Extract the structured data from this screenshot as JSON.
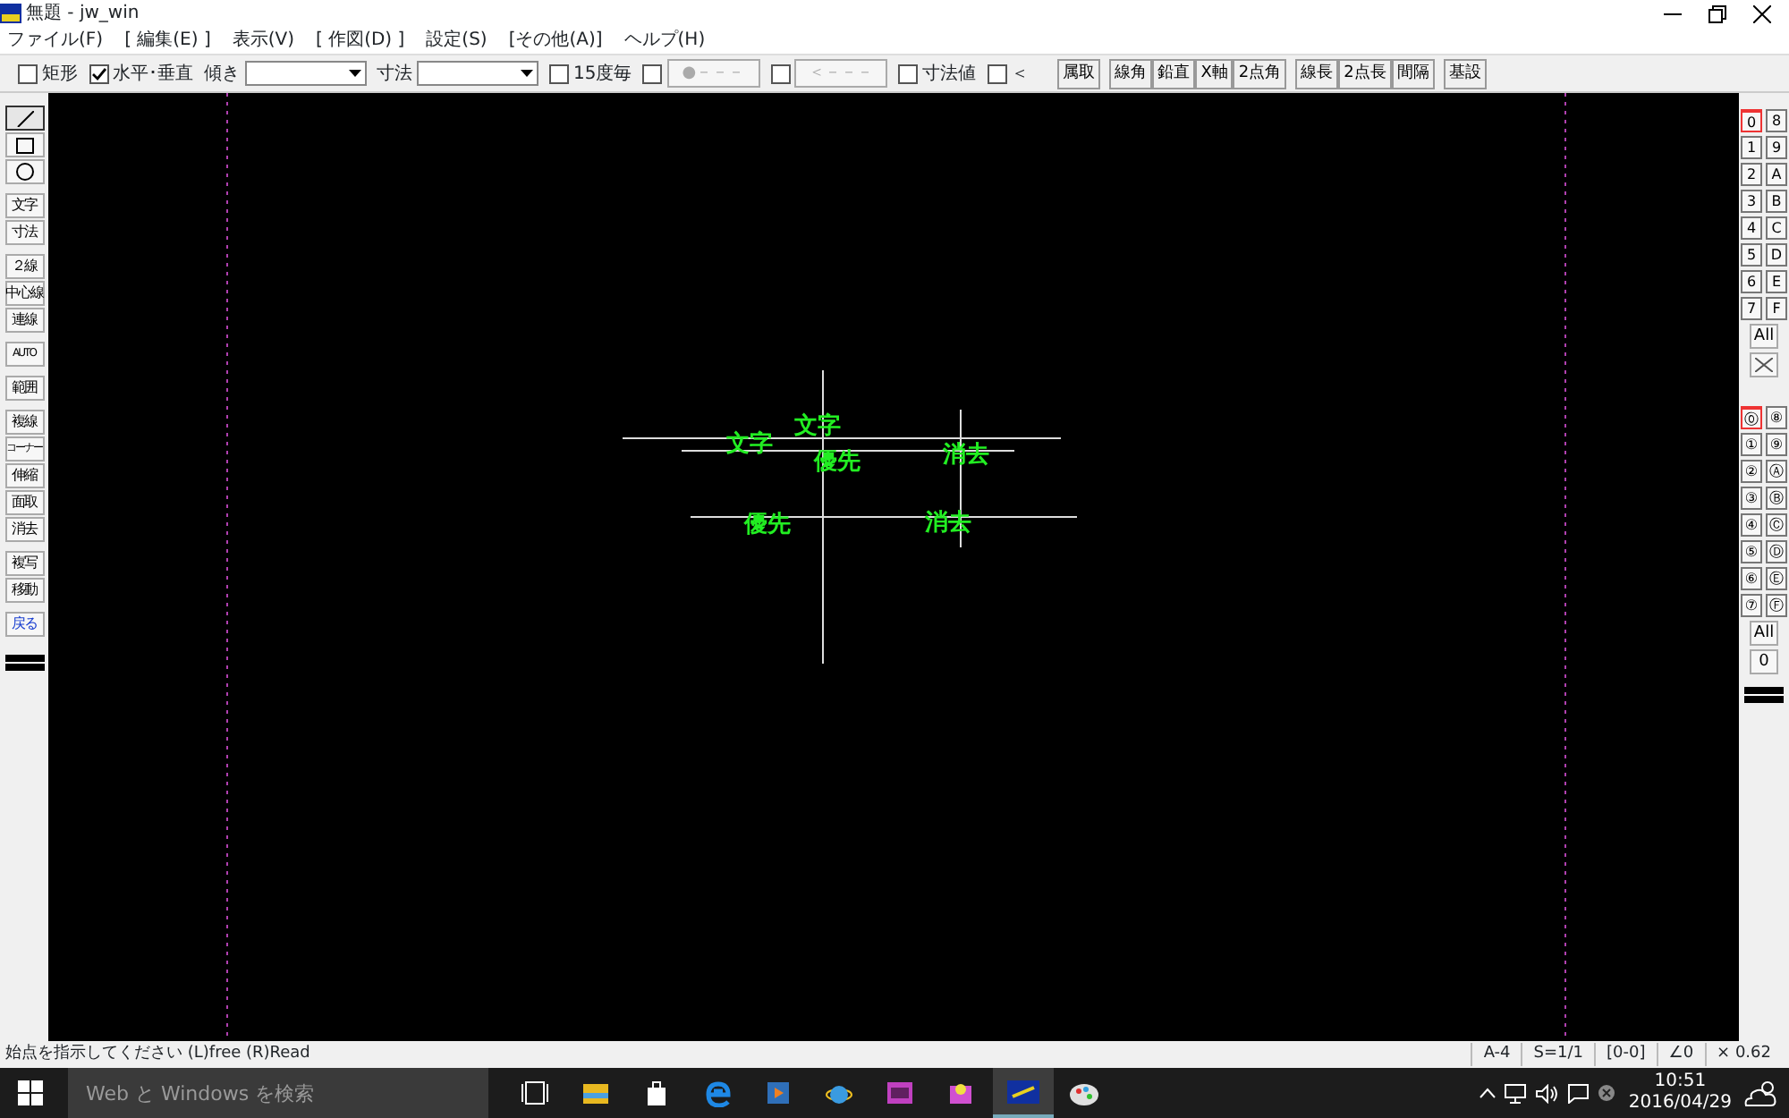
{
  "window": {
    "title": "無題 - jw_win"
  },
  "menu": [
    "ファイル(F)",
    "[ 編集(E) ]",
    "表示(V)",
    "[ 作図(D) ]",
    "設定(S)",
    "[その他(A)]",
    "ヘルプ(H)"
  ],
  "toolbar": {
    "items": [
      {
        "kind": "checkbox",
        "label": "矩形",
        "checked": false
      },
      {
        "kind": "checkbox",
        "label": "水平･垂直",
        "checked": true
      },
      {
        "kind": "combo",
        "label": "傾き"
      },
      {
        "kind": "combo",
        "label": "寸法"
      },
      {
        "kind": "checkbox",
        "label": "15度毎",
        "checked": false
      },
      {
        "kind": "checkbutton",
        "label": "●－－－",
        "checked": false,
        "disabled": true
      },
      {
        "kind": "checkbutton",
        "label": "＜－－－",
        "checked": false,
        "disabled": true
      },
      {
        "kind": "checkbox",
        "label": "寸法値",
        "checked": false
      },
      {
        "kind": "checkbox",
        "label": "＜",
        "checked": false
      }
    ],
    "button_groups": [
      [
        "属取"
      ],
      [
        "線角",
        "鉛直",
        "X軸",
        "2点角"
      ],
      [
        "線長",
        "2点長",
        "間隔"
      ],
      [
        "基設"
      ]
    ]
  },
  "left_tools": [
    [
      {
        "kind": "line",
        "selected": true
      },
      {
        "kind": "rect",
        "selected": false
      },
      {
        "kind": "circle",
        "selected": false
      }
    ],
    [
      {
        "kind": "text",
        "label": "文字",
        "selected": false
      },
      {
        "kind": "text",
        "label": "寸法",
        "selected": false
      }
    ],
    [
      {
        "kind": "text",
        "label": "２線",
        "selected": false
      },
      {
        "kind": "text",
        "label": "中心線",
        "selected": false
      },
      {
        "kind": "text",
        "label": "連線",
        "selected": false
      }
    ],
    [
      {
        "kind": "text",
        "label": "AUTO",
        "selected": false
      }
    ],
    [
      {
        "kind": "text",
        "label": "範囲",
        "selected": false
      }
    ],
    [
      {
        "kind": "text",
        "label": "複線",
        "selected": false
      },
      {
        "kind": "text",
        "label": "コーナー",
        "selected": false
      },
      {
        "kind": "text",
        "label": "伸縮",
        "selected": false
      },
      {
        "kind": "text",
        "label": "面取",
        "selected": false
      },
      {
        "kind": "text",
        "label": "消去",
        "selected": false
      }
    ],
    [
      {
        "kind": "text",
        "label": "複写",
        "selected": false
      },
      {
        "kind": "text",
        "label": "移動",
        "selected": false
      }
    ],
    [
      {
        "kind": "accent",
        "label": "戻る",
        "selected": false
      }
    ]
  ],
  "canvas_texts": [
    "文字",
    "文字",
    "優先",
    "消去",
    "優先",
    "消去"
  ],
  "layer_groups": {
    "items": [
      {
        "label": "0",
        "selected": true
      },
      {
        "label": "8",
        "selected": false
      },
      {
        "label": "1",
        "selected": false
      },
      {
        "label": "9",
        "selected": false
      },
      {
        "label": "2",
        "selected": false
      },
      {
        "label": "A",
        "selected": false
      },
      {
        "label": "3",
        "selected": false
      },
      {
        "label": "B",
        "selected": false
      },
      {
        "label": "4",
        "selected": false
      },
      {
        "label": "C",
        "selected": false
      },
      {
        "label": "5",
        "selected": false
      },
      {
        "label": "D",
        "selected": false
      },
      {
        "label": "6",
        "selected": false
      },
      {
        "label": "E",
        "selected": false
      },
      {
        "label": "7",
        "selected": false
      },
      {
        "label": "F",
        "selected": false
      }
    ],
    "all": "All"
  },
  "layers": {
    "items": [
      {
        "label": "⓪",
        "selected": true
      },
      {
        "label": "⑧",
        "selected": false
      },
      {
        "label": "①",
        "selected": false
      },
      {
        "label": "⑨",
        "selected": false
      },
      {
        "label": "②",
        "selected": false
      },
      {
        "label": "Ⓐ",
        "selected": false
      },
      {
        "label": "③",
        "selected": false
      },
      {
        "label": "Ⓑ",
        "selected": false
      },
      {
        "label": "④",
        "selected": false
      },
      {
        "label": "Ⓒ",
        "selected": false
      },
      {
        "label": "⑤",
        "selected": false
      },
      {
        "label": "Ⓓ",
        "selected": false
      },
      {
        "label": "⑥",
        "selected": false
      },
      {
        "label": "Ⓔ",
        "selected": false
      },
      {
        "label": "⑦",
        "selected": false
      },
      {
        "label": "Ⓕ",
        "selected": false
      }
    ],
    "all": "All",
    "current": "0"
  },
  "status_bar": {
    "message": "始点を指示してください (L)free (R)Read",
    "cells": [
      "A-4",
      "S=1/1",
      "[0-0]",
      "∠0",
      "× 0.62"
    ]
  },
  "taskbar": {
    "search": {
      "placeholder": "Web と Windows を検索"
    },
    "apps": [
      {
        "kind": "taskview",
        "active": false
      },
      {
        "kind": "folder",
        "active": false
      },
      {
        "kind": "store",
        "active": false
      },
      {
        "kind": "edge",
        "active": false
      },
      {
        "kind": "media",
        "active": false
      },
      {
        "kind": "ie",
        "active": false
      },
      {
        "kind": "app",
        "active": false
      },
      {
        "kind": "app2",
        "active": false
      },
      {
        "kind": "jw",
        "active": true
      },
      {
        "kind": "paint",
        "active": false
      }
    ],
    "time": "10:51",
    "date": "2016/04/29"
  }
}
